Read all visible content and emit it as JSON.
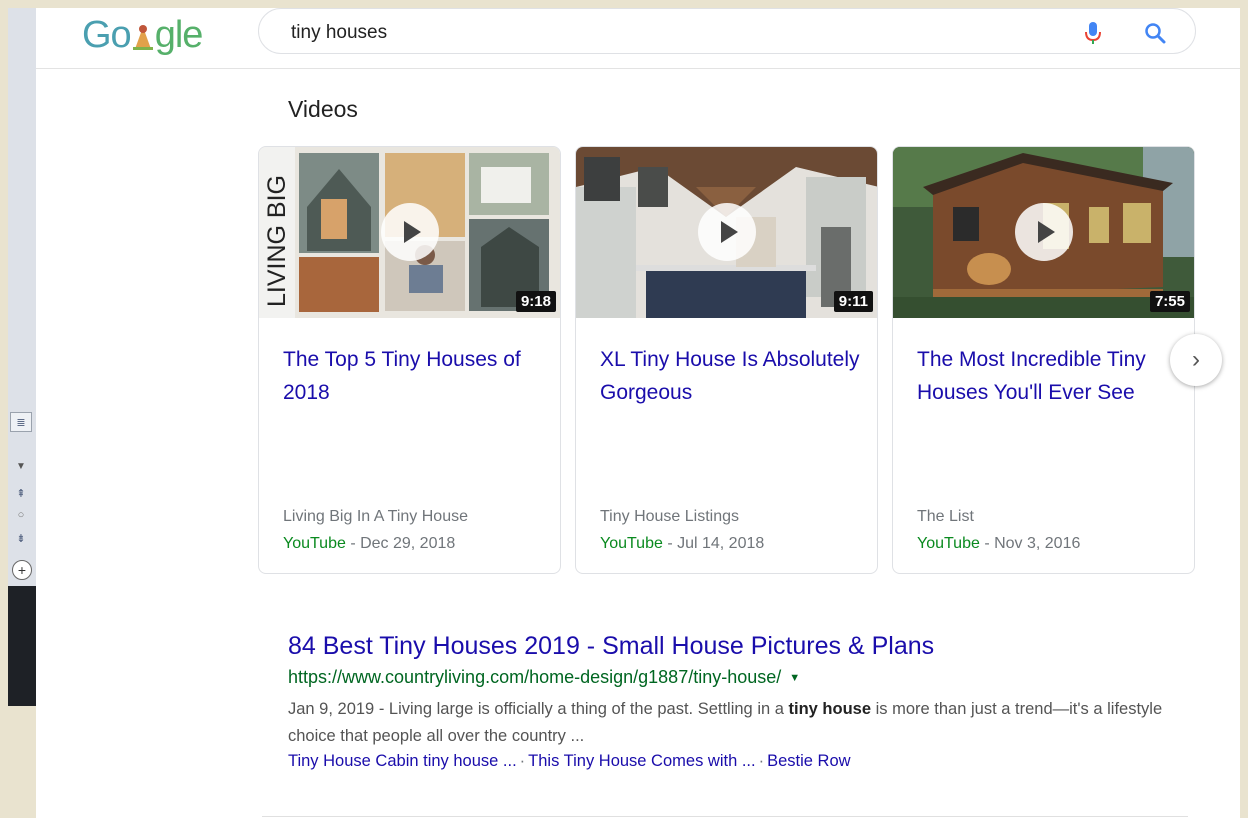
{
  "search": {
    "query": "tiny houses"
  },
  "logo": {
    "text_g": "Go",
    "text_rest": "gle"
  },
  "videos": {
    "heading": "Videos",
    "cards": [
      {
        "title": "The Top 5 Tiny Houses of 2018",
        "channel": "Living Big In A Tiny House",
        "source": "YouTube",
        "date": " - Dec 29, 2018",
        "duration": "9:18",
        "thumb_text": "LIVING BIG"
      },
      {
        "title": "XL Tiny House Is Absolutely Gorgeous",
        "channel": "Tiny House Listings",
        "source": "YouTube",
        "date": " - Jul 14, 2018",
        "duration": "9:11"
      },
      {
        "title": "The Most Incredible Tiny Houses You'll Ever See",
        "channel": "The List",
        "source": "YouTube",
        "date": " - Nov 3, 2016",
        "duration": "7:55"
      }
    ]
  },
  "result": {
    "title": "84 Best Tiny Houses 2019 - Small House Pictures & Plans",
    "url": "https://www.countryliving.com/home-design/g1887/tiny-house/",
    "snippet_date": "Jan 9, 2019",
    "snippet_pre": " - Living large is officially a thing of the past. Settling in a ",
    "snippet_bold": "tiny house",
    "snippet_post": " is more than just a trend—it's a lifestyle choice that people all over the country ...",
    "sitelinks": [
      "Tiny House Cabin tiny house ...",
      "This Tiny House Comes with ...",
      "Bestie Row"
    ]
  },
  "colors": {
    "link": "#1a0dab",
    "url": "#006621",
    "source": "#0a8a1f",
    "logo": "#5aa7b3"
  },
  "icons": [
    "mic-icon",
    "search-icon",
    "play-icon",
    "chevron-right-icon",
    "dropdown-caret-icon"
  ]
}
